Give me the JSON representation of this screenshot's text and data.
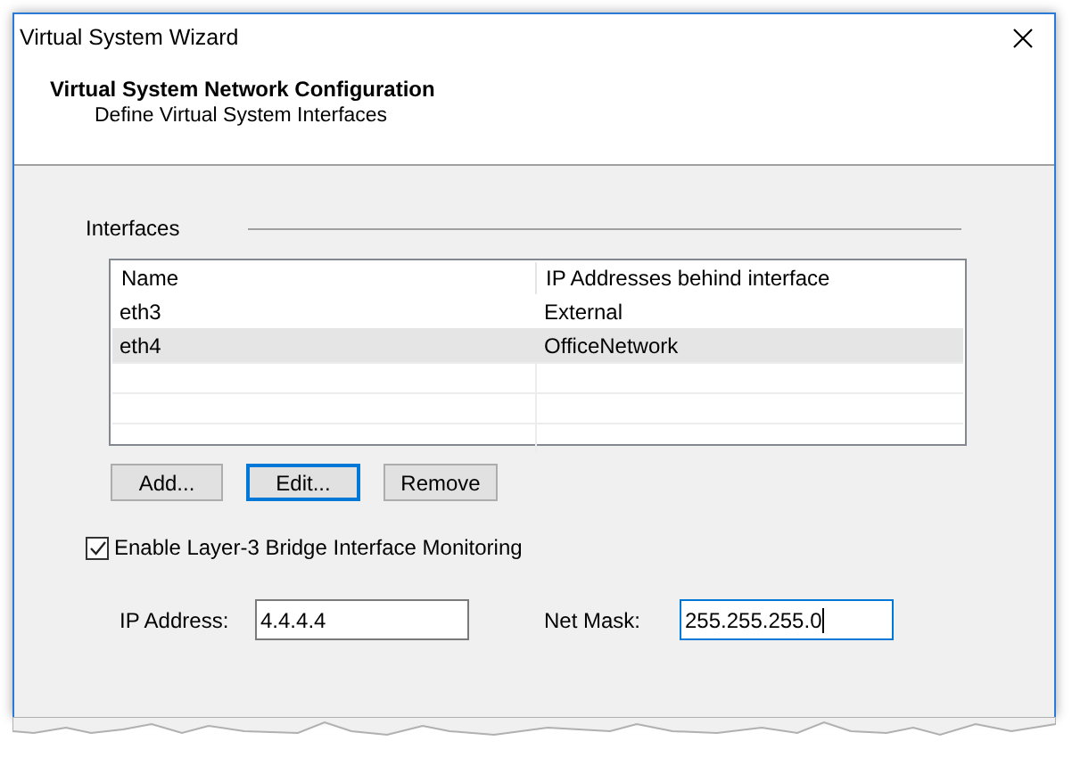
{
  "window": {
    "title": "Virtual System Wizard"
  },
  "header": {
    "title": "Virtual System Network Configuration",
    "subtitle": "Define Virtual System Interfaces"
  },
  "interfaces": {
    "label": "Interfaces",
    "columns": [
      "Name",
      "IP Addresses behind interface"
    ],
    "rows": [
      {
        "cells": [
          "eth3",
          "External"
        ],
        "selected": false
      },
      {
        "cells": [
          "eth4",
          "OfficeNetwork"
        ],
        "selected": true
      }
    ]
  },
  "buttons": [
    {
      "label": "Add...",
      "focused": false
    },
    {
      "label": "Edit...",
      "focused": true
    },
    {
      "label": "Remove",
      "focused": false
    }
  ],
  "bridge_monitoring": {
    "label": "Enable Layer-3 Bridge Interface Monitoring",
    "checked": true
  },
  "fields": [
    {
      "label": "IP Address:",
      "value": "4.4.4.4",
      "focused": false
    },
    {
      "label": "Net Mask:",
      "value": "255.255.255.0",
      "focused": true
    }
  ]
}
